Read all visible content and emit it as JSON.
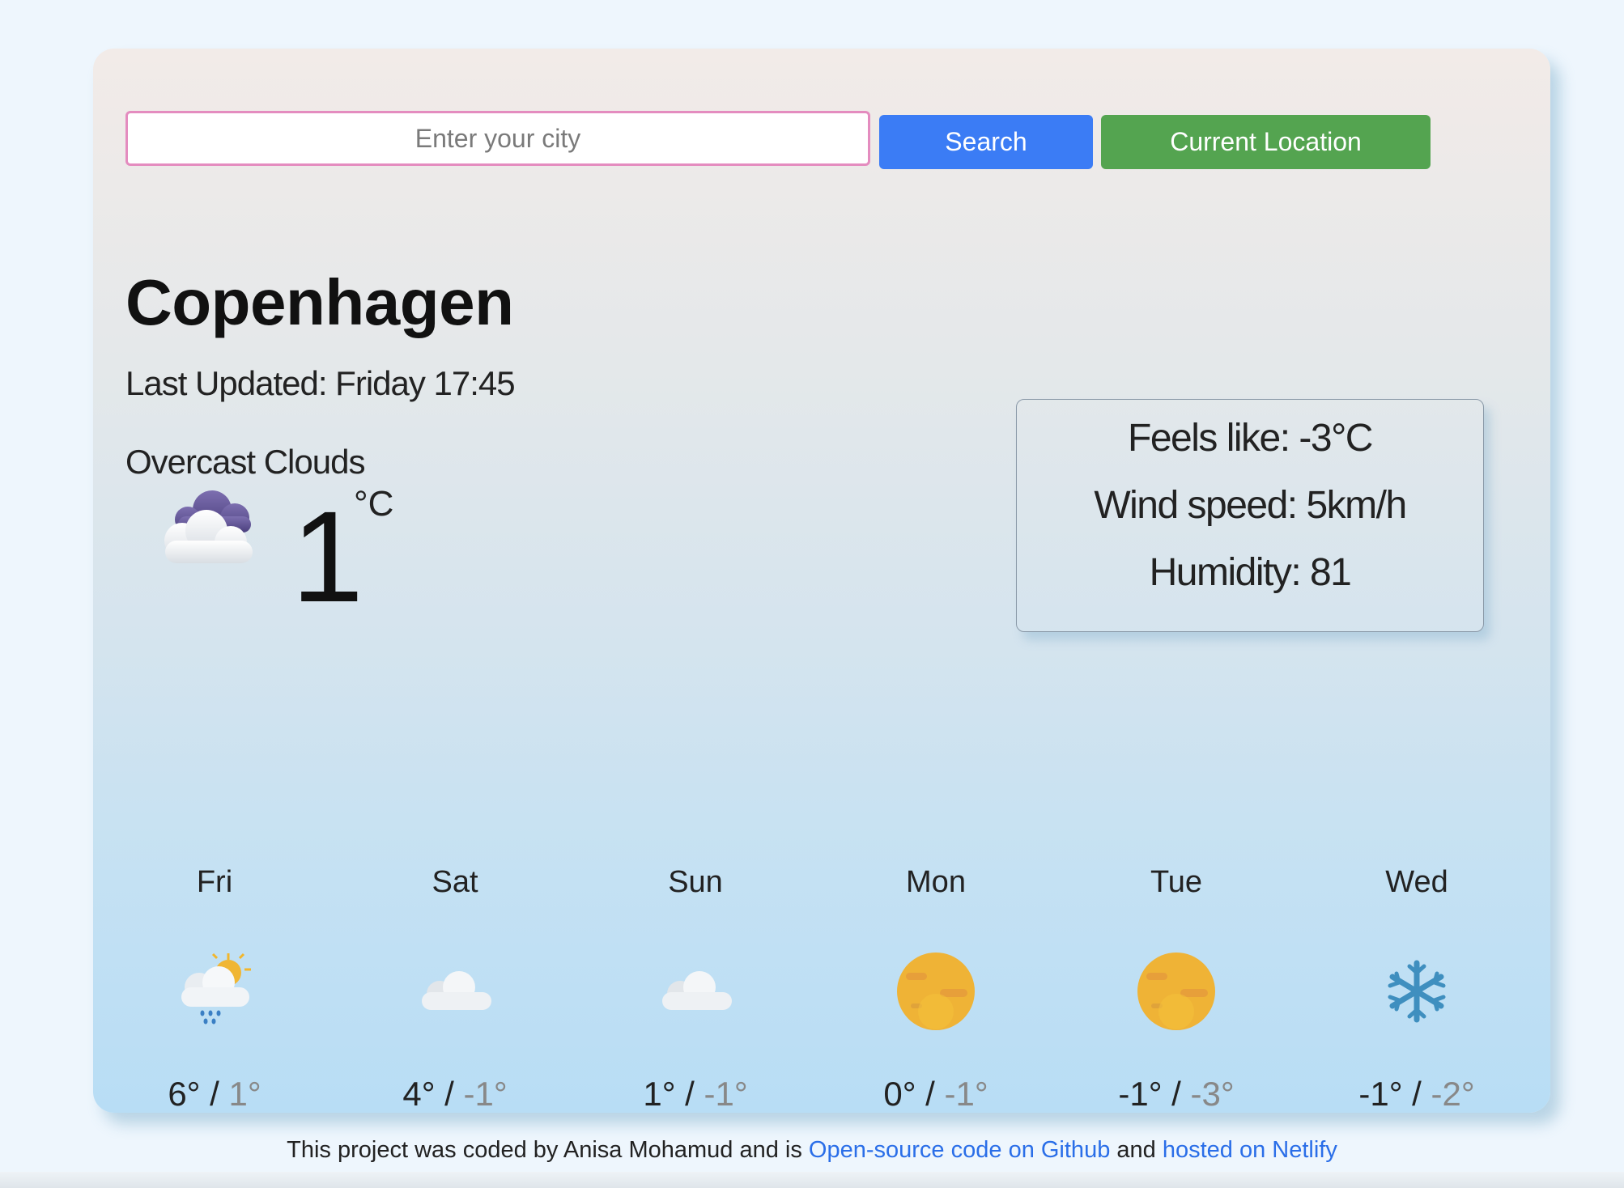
{
  "search": {
    "placeholder": "Enter your city",
    "search_label": "Search",
    "location_label": "Current Location"
  },
  "current": {
    "city": "Copenhagen",
    "last_updated": "Last Updated: Friday 17:45",
    "description": "Overcast Clouds",
    "icon": "overcast-clouds-icon",
    "temperature": "1",
    "unit": "°C"
  },
  "details": {
    "feels_like": "Feels like: -3°C",
    "wind_speed": "Wind speed: 5km/h",
    "humidity": "Humidity: 81"
  },
  "forecast": [
    {
      "day": "Fri",
      "icon": "sun-cloud-rain-icon",
      "high": "6°",
      "low": "1°"
    },
    {
      "day": "Sat",
      "icon": "cloud-icon",
      "high": "4°",
      "low": "-1°"
    },
    {
      "day": "Sun",
      "icon": "cloud-icon",
      "high": "1°",
      "low": "-1°"
    },
    {
      "day": "Mon",
      "icon": "sun-haze-icon",
      "high": "0°",
      "low": "-1°"
    },
    {
      "day": "Tue",
      "icon": "sun-haze-icon",
      "high": "-1°",
      "low": "-3°"
    },
    {
      "day": "Wed",
      "icon": "snowflake-icon",
      "high": "-1°",
      "low": "-2°"
    }
  ],
  "footer": {
    "prefix": "This project was coded by Anisa Mohamud and is",
    "github_link": "Open-source code on Github",
    "middle": "and",
    "netlify_link": "hosted on Netlify"
  },
  "colors": {
    "search_button": "#3b7cf5",
    "location_button": "#54a450",
    "input_border": "#e48cbf",
    "link": "#2a6ee8"
  }
}
